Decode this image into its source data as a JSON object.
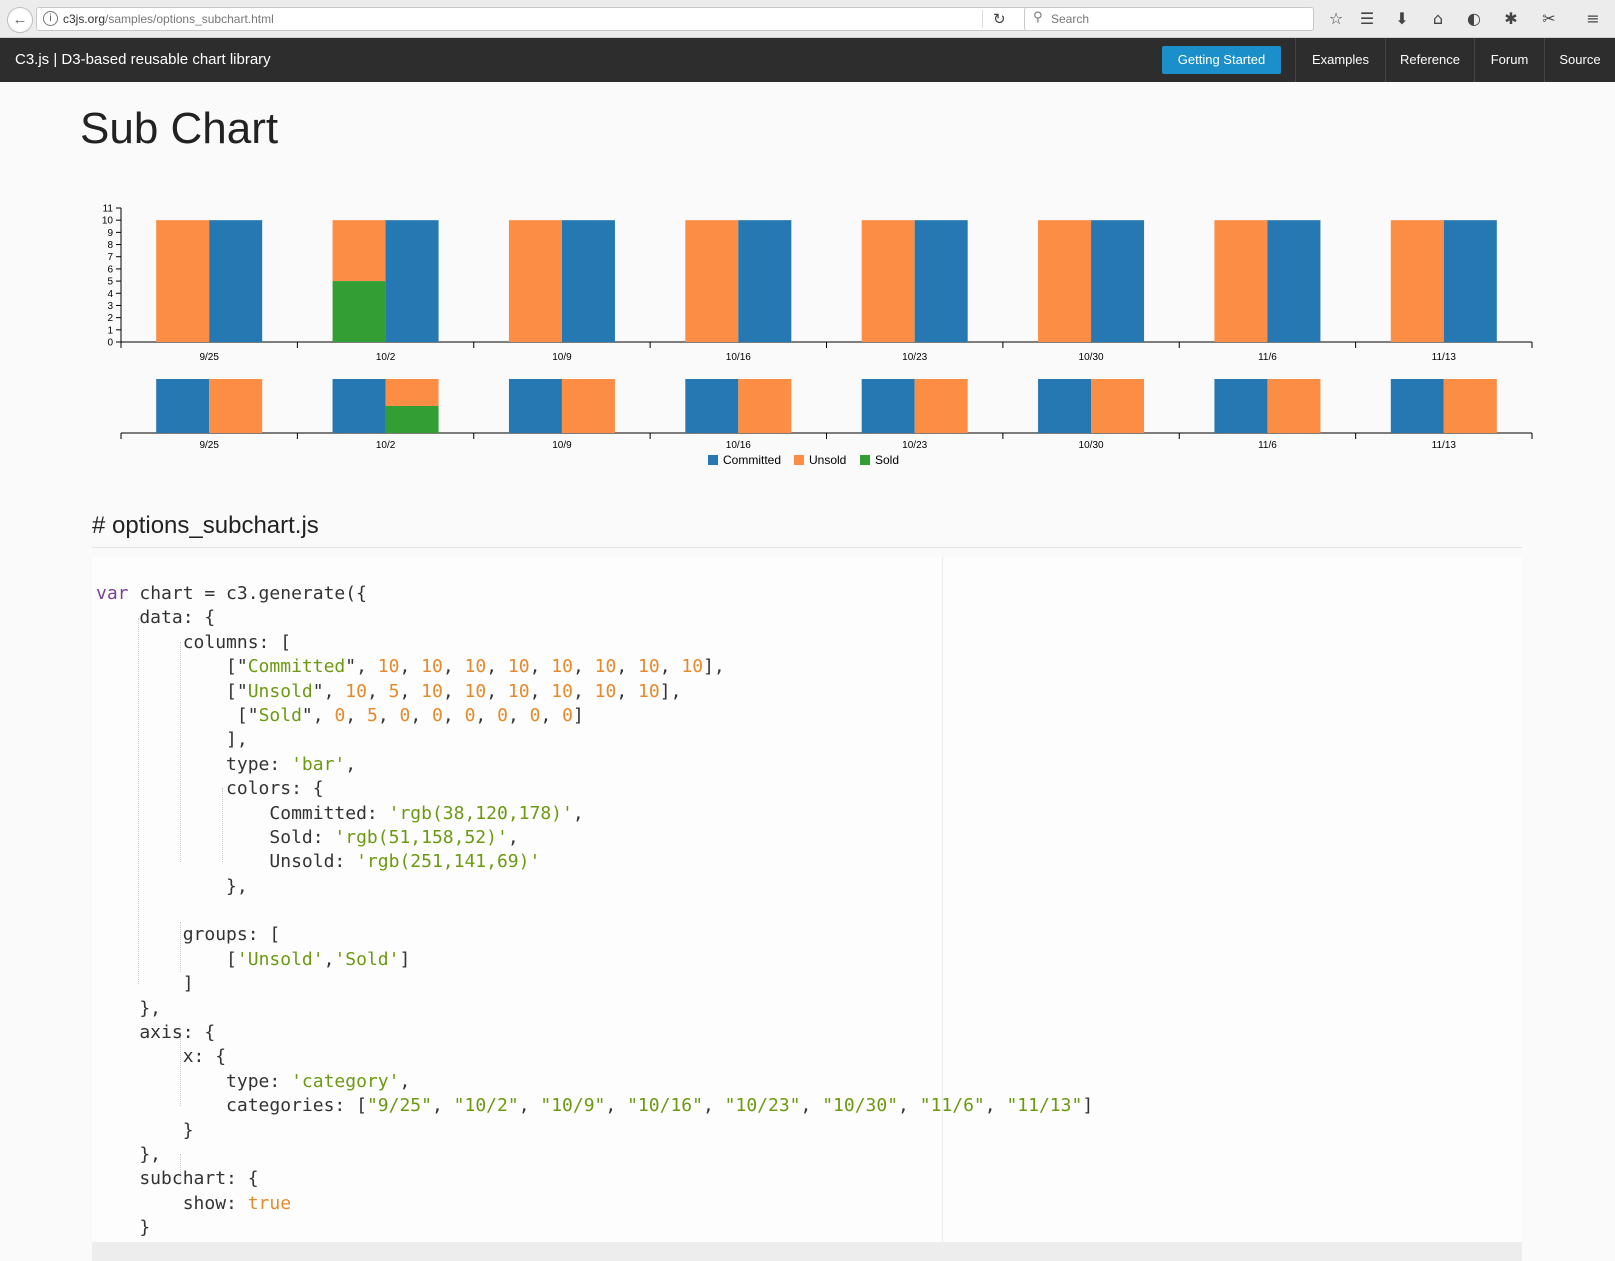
{
  "browser": {
    "url_host": "c3js.org",
    "url_path": "/samples/options_subchart.html",
    "search_placeholder": "Search"
  },
  "icons": [
    "back-icon",
    "info-icon",
    "reload-icon",
    "search-icon",
    "bookmark-star-icon",
    "reader-list-icon",
    "download-icon",
    "home-icon",
    "pocket-icon",
    "extension-icon",
    "screenshot-icon",
    "menu-icon"
  ],
  "nav": {
    "brand": "C3.js | D3-based reusable chart library",
    "primary_button": "Getting Started",
    "links": [
      "Examples",
      "Reference",
      "Forum",
      "Source"
    ]
  },
  "page": {
    "title": "Sub Chart",
    "code_heading": "# options_subchart.js"
  },
  "colors": {
    "Committed": "#2678b2",
    "Unsold": "#fb8d45",
    "Sold": "#339e34",
    "nav_bg": "#2d2d2d",
    "primary": "#1a8fca"
  },
  "chart_data": {
    "type": "bar",
    "categories": [
      "9/25",
      "10/2",
      "10/9",
      "10/16",
      "10/23",
      "10/30",
      "11/6",
      "11/13"
    ],
    "series": [
      {
        "name": "Committed",
        "values": [
          10,
          10,
          10,
          10,
          10,
          10,
          10,
          10
        ]
      },
      {
        "name": "Unsold",
        "values": [
          10,
          5,
          10,
          10,
          10,
          10,
          10,
          10
        ]
      },
      {
        "name": "Sold",
        "values": [
          0,
          5,
          0,
          0,
          0,
          0,
          0,
          0
        ]
      }
    ],
    "groups": [
      [
        "Unsold",
        "Sold"
      ]
    ],
    "ylim": [
      0,
      11
    ],
    "yticks": [
      0,
      1,
      2,
      3,
      4,
      5,
      6,
      7,
      8,
      9,
      10,
      11
    ],
    "subchart": true,
    "legend": "bottom-center",
    "grid": false
  },
  "code": [
    [
      [
        "var",
        "k"
      ],
      [
        " chart = c3.generate({",
        "p"
      ]
    ],
    [
      [
        "    data: {",
        "p"
      ]
    ],
    [
      [
        "        columns: [",
        "p"
      ]
    ],
    [
      [
        "            [\"",
        "p"
      ],
      [
        "Committed",
        "s"
      ],
      [
        "\", ",
        "p"
      ],
      [
        "10",
        "n"
      ],
      [
        ", ",
        "p"
      ],
      [
        "10",
        "n"
      ],
      [
        ", ",
        "p"
      ],
      [
        "10",
        "n"
      ],
      [
        ", ",
        "p"
      ],
      [
        "10",
        "n"
      ],
      [
        ", ",
        "p"
      ],
      [
        "10",
        "n"
      ],
      [
        ", ",
        "p"
      ],
      [
        "10",
        "n"
      ],
      [
        ", ",
        "p"
      ],
      [
        "10",
        "n"
      ],
      [
        ", ",
        "p"
      ],
      [
        "10",
        "n"
      ],
      [
        "],",
        "p"
      ]
    ],
    [
      [
        "            [\"",
        "p"
      ],
      [
        "Unsold",
        "s"
      ],
      [
        "\", ",
        "p"
      ],
      [
        "10",
        "n"
      ],
      [
        ", ",
        "p"
      ],
      [
        "5",
        "n"
      ],
      [
        ", ",
        "p"
      ],
      [
        "10",
        "n"
      ],
      [
        ", ",
        "p"
      ],
      [
        "10",
        "n"
      ],
      [
        ", ",
        "p"
      ],
      [
        "10",
        "n"
      ],
      [
        ", ",
        "p"
      ],
      [
        "10",
        "n"
      ],
      [
        ", ",
        "p"
      ],
      [
        "10",
        "n"
      ],
      [
        ", ",
        "p"
      ],
      [
        "10",
        "n"
      ],
      [
        "],",
        "p"
      ]
    ],
    [
      [
        "             [\"",
        "p"
      ],
      [
        "Sold",
        "s"
      ],
      [
        "\", ",
        "p"
      ],
      [
        "0",
        "n"
      ],
      [
        ", ",
        "p"
      ],
      [
        "5",
        "n"
      ],
      [
        ", ",
        "p"
      ],
      [
        "0",
        "n"
      ],
      [
        ", ",
        "p"
      ],
      [
        "0",
        "n"
      ],
      [
        ", ",
        "p"
      ],
      [
        "0",
        "n"
      ],
      [
        ", ",
        "p"
      ],
      [
        "0",
        "n"
      ],
      [
        ", ",
        "p"
      ],
      [
        "0",
        "n"
      ],
      [
        ", ",
        "p"
      ],
      [
        "0",
        "n"
      ],
      [
        "]",
        "p"
      ]
    ],
    [
      [
        "            ],",
        "p"
      ]
    ],
    [
      [
        "            type: ",
        "p"
      ],
      [
        "'bar'",
        "s"
      ],
      [
        ",",
        "p"
      ]
    ],
    [
      [
        "            colors: {",
        "p"
      ]
    ],
    [
      [
        "                Committed: ",
        "p"
      ],
      [
        "'rgb(38,120,178)'",
        "s"
      ],
      [
        ",",
        "p"
      ]
    ],
    [
      [
        "                Sold: ",
        "p"
      ],
      [
        "'rgb(51,158,52)'",
        "s"
      ],
      [
        ",",
        "p"
      ]
    ],
    [
      [
        "                Unsold: ",
        "p"
      ],
      [
        "'rgb(251,141,69)'",
        "s"
      ]
    ],
    [
      [
        "            },",
        "p"
      ]
    ],
    [
      [
        "",
        "p"
      ]
    ],
    [
      [
        "        groups: [",
        "p"
      ]
    ],
    [
      [
        "            [",
        "p"
      ],
      [
        "'Unsold'",
        "s"
      ],
      [
        ",",
        "p"
      ],
      [
        "'Sold'",
        "s"
      ],
      [
        "]",
        "p"
      ]
    ],
    [
      [
        "        ]",
        "p"
      ]
    ],
    [
      [
        "    },",
        "p"
      ]
    ],
    [
      [
        "    axis: {",
        "p"
      ]
    ],
    [
      [
        "        x: {",
        "p"
      ]
    ],
    [
      [
        "            type: ",
        "p"
      ],
      [
        "'category'",
        "s"
      ],
      [
        ",",
        "p"
      ]
    ],
    [
      [
        "            categories: [",
        "p"
      ],
      [
        "\"9/25\"",
        "s"
      ],
      [
        ", ",
        "p"
      ],
      [
        "\"10/2\"",
        "s"
      ],
      [
        ", ",
        "p"
      ],
      [
        "\"10/9\"",
        "s"
      ],
      [
        ", ",
        "p"
      ],
      [
        "\"10/16\"",
        "s"
      ],
      [
        ", ",
        "p"
      ],
      [
        "\"10/23\"",
        "s"
      ],
      [
        ", ",
        "p"
      ],
      [
        "\"10/30\"",
        "s"
      ],
      [
        ", ",
        "p"
      ],
      [
        "\"11/6\"",
        "s"
      ],
      [
        ", ",
        "p"
      ],
      [
        "\"11/13\"",
        "s"
      ],
      [
        "]",
        "p"
      ]
    ],
    [
      [
        "        }",
        "p"
      ]
    ],
    [
      [
        "    },",
        "p"
      ]
    ],
    [
      [
        "    subchart: {",
        "p"
      ]
    ],
    [
      [
        "        show: ",
        "p"
      ],
      [
        "true",
        "n"
      ]
    ],
    [
      [
        "    }",
        "p"
      ]
    ],
    [
      [
        "});",
        "p"
      ]
    ]
  ]
}
